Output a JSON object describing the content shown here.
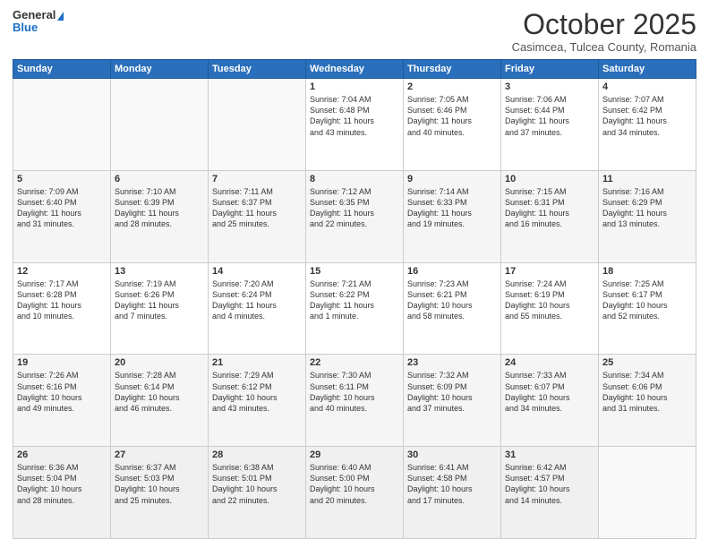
{
  "header": {
    "logo_general": "General",
    "logo_blue": "Blue",
    "month_title": "October 2025",
    "subtitle": "Casimcea, Tulcea County, Romania"
  },
  "days_of_week": [
    "Sunday",
    "Monday",
    "Tuesday",
    "Wednesday",
    "Thursday",
    "Friday",
    "Saturday"
  ],
  "weeks": [
    [
      {
        "day": "",
        "info": ""
      },
      {
        "day": "",
        "info": ""
      },
      {
        "day": "",
        "info": ""
      },
      {
        "day": "1",
        "info": "Sunrise: 7:04 AM\nSunset: 6:48 PM\nDaylight: 11 hours\nand 43 minutes."
      },
      {
        "day": "2",
        "info": "Sunrise: 7:05 AM\nSunset: 6:46 PM\nDaylight: 11 hours\nand 40 minutes."
      },
      {
        "day": "3",
        "info": "Sunrise: 7:06 AM\nSunset: 6:44 PM\nDaylight: 11 hours\nand 37 minutes."
      },
      {
        "day": "4",
        "info": "Sunrise: 7:07 AM\nSunset: 6:42 PM\nDaylight: 11 hours\nand 34 minutes."
      }
    ],
    [
      {
        "day": "5",
        "info": "Sunrise: 7:09 AM\nSunset: 6:40 PM\nDaylight: 11 hours\nand 31 minutes."
      },
      {
        "day": "6",
        "info": "Sunrise: 7:10 AM\nSunset: 6:39 PM\nDaylight: 11 hours\nand 28 minutes."
      },
      {
        "day": "7",
        "info": "Sunrise: 7:11 AM\nSunset: 6:37 PM\nDaylight: 11 hours\nand 25 minutes."
      },
      {
        "day": "8",
        "info": "Sunrise: 7:12 AM\nSunset: 6:35 PM\nDaylight: 11 hours\nand 22 minutes."
      },
      {
        "day": "9",
        "info": "Sunrise: 7:14 AM\nSunset: 6:33 PM\nDaylight: 11 hours\nand 19 minutes."
      },
      {
        "day": "10",
        "info": "Sunrise: 7:15 AM\nSunset: 6:31 PM\nDaylight: 11 hours\nand 16 minutes."
      },
      {
        "day": "11",
        "info": "Sunrise: 7:16 AM\nSunset: 6:29 PM\nDaylight: 11 hours\nand 13 minutes."
      }
    ],
    [
      {
        "day": "12",
        "info": "Sunrise: 7:17 AM\nSunset: 6:28 PM\nDaylight: 11 hours\nand 10 minutes."
      },
      {
        "day": "13",
        "info": "Sunrise: 7:19 AM\nSunset: 6:26 PM\nDaylight: 11 hours\nand 7 minutes."
      },
      {
        "day": "14",
        "info": "Sunrise: 7:20 AM\nSunset: 6:24 PM\nDaylight: 11 hours\nand 4 minutes."
      },
      {
        "day": "15",
        "info": "Sunrise: 7:21 AM\nSunset: 6:22 PM\nDaylight: 11 hours\nand 1 minute."
      },
      {
        "day": "16",
        "info": "Sunrise: 7:23 AM\nSunset: 6:21 PM\nDaylight: 10 hours\nand 58 minutes."
      },
      {
        "day": "17",
        "info": "Sunrise: 7:24 AM\nSunset: 6:19 PM\nDaylight: 10 hours\nand 55 minutes."
      },
      {
        "day": "18",
        "info": "Sunrise: 7:25 AM\nSunset: 6:17 PM\nDaylight: 10 hours\nand 52 minutes."
      }
    ],
    [
      {
        "day": "19",
        "info": "Sunrise: 7:26 AM\nSunset: 6:16 PM\nDaylight: 10 hours\nand 49 minutes."
      },
      {
        "day": "20",
        "info": "Sunrise: 7:28 AM\nSunset: 6:14 PM\nDaylight: 10 hours\nand 46 minutes."
      },
      {
        "day": "21",
        "info": "Sunrise: 7:29 AM\nSunset: 6:12 PM\nDaylight: 10 hours\nand 43 minutes."
      },
      {
        "day": "22",
        "info": "Sunrise: 7:30 AM\nSunset: 6:11 PM\nDaylight: 10 hours\nand 40 minutes."
      },
      {
        "day": "23",
        "info": "Sunrise: 7:32 AM\nSunset: 6:09 PM\nDaylight: 10 hours\nand 37 minutes."
      },
      {
        "day": "24",
        "info": "Sunrise: 7:33 AM\nSunset: 6:07 PM\nDaylight: 10 hours\nand 34 minutes."
      },
      {
        "day": "25",
        "info": "Sunrise: 7:34 AM\nSunset: 6:06 PM\nDaylight: 10 hours\nand 31 minutes."
      }
    ],
    [
      {
        "day": "26",
        "info": "Sunrise: 6:36 AM\nSunset: 5:04 PM\nDaylight: 10 hours\nand 28 minutes."
      },
      {
        "day": "27",
        "info": "Sunrise: 6:37 AM\nSunset: 5:03 PM\nDaylight: 10 hours\nand 25 minutes."
      },
      {
        "day": "28",
        "info": "Sunrise: 6:38 AM\nSunset: 5:01 PM\nDaylight: 10 hours\nand 22 minutes."
      },
      {
        "day": "29",
        "info": "Sunrise: 6:40 AM\nSunset: 5:00 PM\nDaylight: 10 hours\nand 20 minutes."
      },
      {
        "day": "30",
        "info": "Sunrise: 6:41 AM\nSunset: 4:58 PM\nDaylight: 10 hours\nand 17 minutes."
      },
      {
        "day": "31",
        "info": "Sunrise: 6:42 AM\nSunset: 4:57 PM\nDaylight: 10 hours\nand 14 minutes."
      },
      {
        "day": "",
        "info": ""
      }
    ]
  ]
}
